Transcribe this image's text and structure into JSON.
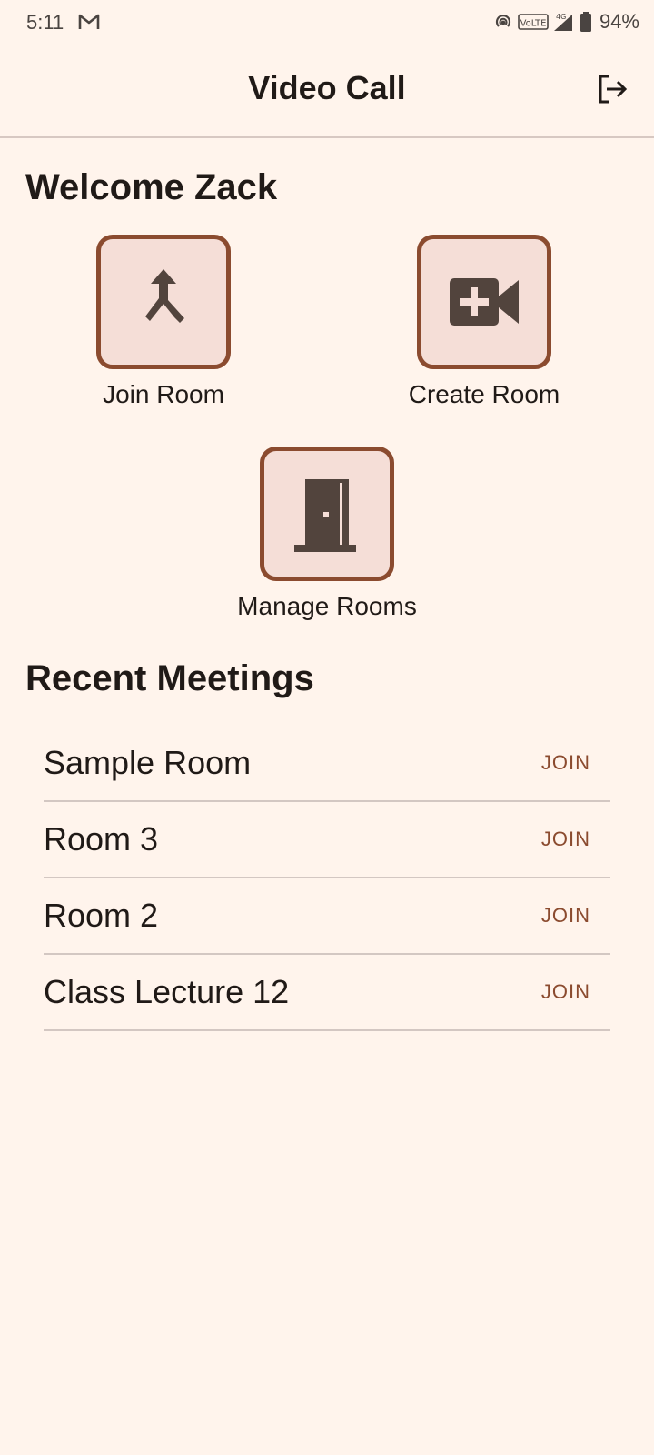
{
  "status_bar": {
    "time": "5:11",
    "battery": "94%",
    "icons": [
      "gmail-icon",
      "hotspot-icon",
      "volte-icon",
      "signal-4g-icon",
      "battery-icon"
    ]
  },
  "app_bar": {
    "title": "Video Call",
    "logout_icon": "logout-icon"
  },
  "welcome": "Welcome Zack",
  "actions": {
    "join_room": "Join Room",
    "create_room": "Create Room",
    "manage_rooms": "Manage Rooms"
  },
  "recent": {
    "title": "Recent Meetings",
    "join_label": "JOIN",
    "meetings": [
      {
        "name": "Sample Room"
      },
      {
        "name": "Room 3"
      },
      {
        "name": "Room 2"
      },
      {
        "name": "Class Lecture 12"
      }
    ]
  },
  "colors": {
    "background": "#fff4ec",
    "accent": "#8b4b2f",
    "tile_fill": "#f5ded7",
    "icon": "#52443d"
  }
}
